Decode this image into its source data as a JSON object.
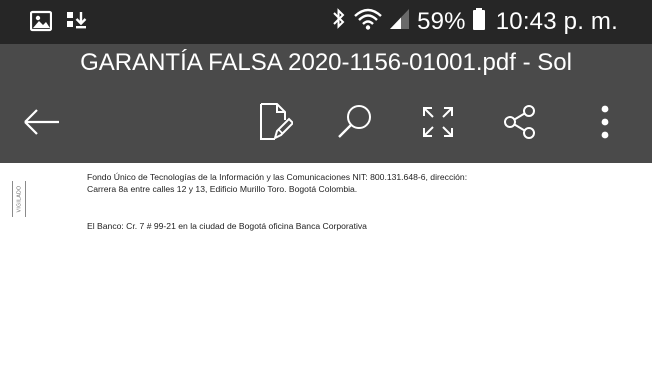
{
  "status_bar": {
    "battery": "59%",
    "time": "10:43 p. m.",
    "icons": [
      "image-notification-icon",
      "download-notification-icon",
      "bluetooth-icon",
      "wifi-icon",
      "signal-icon",
      "battery-icon"
    ]
  },
  "app_bar": {
    "title": "GARANTÍA FALSA 2020-1156-01001.pdf - Sol",
    "actions": [
      "back-arrow-icon",
      "edit-document-icon",
      "search-icon",
      "fullscreen-icon",
      "share-icon",
      "more-options-icon"
    ]
  },
  "document": {
    "side_stamp": "VIGILADO",
    "lines": [
      "Fondo Único de Tecnologías de la Información y las Comunicaciones NIT: 800.131.648-6, dirección:",
      "Carrera 8a entre calles 12 y 13, Edificio Murillo Toro. Bogotá Colombia.",
      "El Banco: Cr. 7 # 99-21 en la ciudad de Bogotá oficina Banca Corporativa"
    ]
  },
  "colors": {
    "status_bar_bg": "#262626",
    "app_bar_bg": "#4a4a4a",
    "page_bg": "#ffffff",
    "text": "#222222"
  }
}
